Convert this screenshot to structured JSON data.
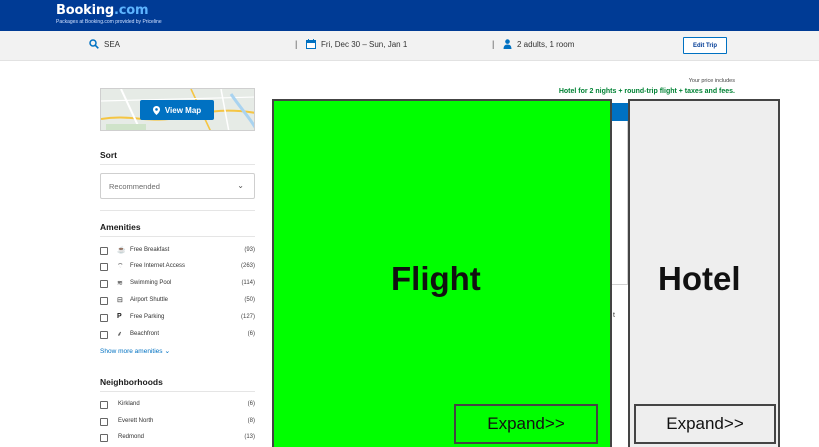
{
  "header": {
    "logo_main": "Booking",
    "logo_suffix": ".com",
    "tagline": "Packages at Booking.com provided by Priceline"
  },
  "searchbar": {
    "destination": "SEA",
    "dates": "Fri, Dec 30 – Sun, Jan 1",
    "guests": "2 adults, 1 room",
    "separator": "|",
    "edit_label": "Edit Trip"
  },
  "map": {
    "button_label": "View Map"
  },
  "sort": {
    "title": "Sort",
    "selected": "Recommended"
  },
  "amenities": {
    "title": "Amenities",
    "items": [
      {
        "label": "Free Breakfast",
        "count": "(93)",
        "icon": "☕"
      },
      {
        "label": "Free Internet Access",
        "count": "(263)",
        "icon": "⌔"
      },
      {
        "label": "Swimming Pool",
        "count": "(114)",
        "icon": "≋"
      },
      {
        "label": "Airport Shuttle",
        "count": "(50)",
        "icon": "⊟"
      },
      {
        "label": "Free Parking",
        "count": "(127)",
        "icon": "P"
      },
      {
        "label": "Beachfront",
        "count": "(6)",
        "icon": "⸙"
      }
    ],
    "show_more": "Show more amenities"
  },
  "neighborhoods": {
    "title": "Neighborhoods",
    "items": [
      {
        "label": "Kirkland",
        "count": "(6)"
      },
      {
        "label": "Everett North",
        "count": "(8)"
      },
      {
        "label": "Redmond",
        "count": "(13)"
      }
    ]
  },
  "price_info": {
    "includes": "Your price includes",
    "description": "Hotel for 2 nights + round-trip flight + taxes and fees."
  },
  "underlay": {
    "fragment": "t"
  },
  "overlay": {
    "flight": {
      "label": "Flight",
      "expand": "Expand>>",
      "color": "#00ff00"
    },
    "hotel": {
      "label": "Hotel",
      "expand": "Expand>>",
      "color": "#eeeeee"
    }
  },
  "colors": {
    "brand_blue": "#003b95",
    "link_blue": "#0071c2",
    "price_green": "#008234"
  }
}
